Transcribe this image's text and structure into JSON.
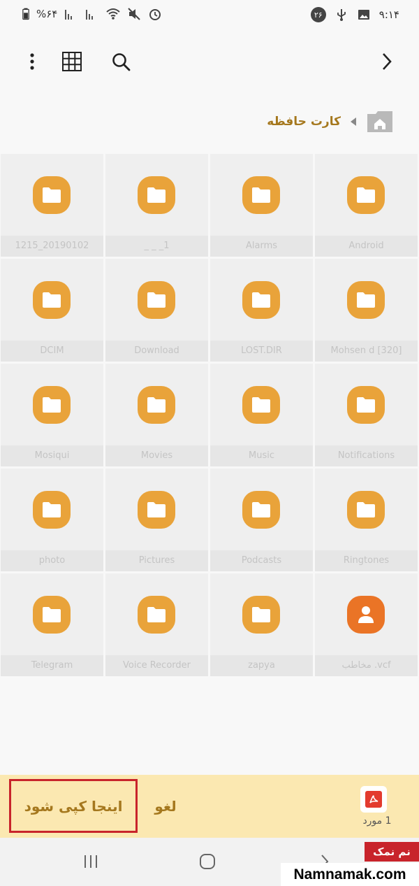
{
  "status_bar": {
    "battery": "%۶۴",
    "time": "۹:۱۴",
    "badge": "۲۶"
  },
  "toolbar": {
    "more_icon": "more-vert-icon",
    "grid_icon": "grid-view-icon",
    "search_icon": "search-icon",
    "back_icon": "chevron-right-icon"
  },
  "breadcrumb": {
    "label": "کارت حافظه",
    "home_icon": "home-icon"
  },
  "folders": [
    {
      "name": "Android",
      "type": "folder"
    },
    {
      "name": "Alarms",
      "type": "folder"
    },
    {
      "name": "_ _ _1",
      "type": "folder"
    },
    {
      "name": "1215_20190102",
      "type": "folder"
    },
    {
      "name": "Mohsen  d [320]",
      "type": "folder"
    },
    {
      "name": "LOST.DIR",
      "type": "folder"
    },
    {
      "name": "Download",
      "type": "folder"
    },
    {
      "name": "DCIM",
      "type": "folder"
    },
    {
      "name": "Notifications",
      "type": "folder"
    },
    {
      "name": "Music",
      "type": "folder"
    },
    {
      "name": "Movies",
      "type": "folder"
    },
    {
      "name": "Mosiqui",
      "type": "folder"
    },
    {
      "name": "Ringtones",
      "type": "folder"
    },
    {
      "name": "Podcasts",
      "type": "folder"
    },
    {
      "name": "Pictures",
      "type": "folder"
    },
    {
      "name": "photo",
      "type": "folder"
    },
    {
      "name": "مخاطب .vcf",
      "type": "contact"
    },
    {
      "name": "zapya",
      "type": "folder"
    },
    {
      "name": "Voice Recorder",
      "type": "folder"
    },
    {
      "name": "Telegram",
      "type": "folder"
    }
  ],
  "action_bar": {
    "copy_label": "اینجا کپی شود",
    "cancel_label": "لغو",
    "count_label": "1 مورد",
    "file_icon": "pdf-icon"
  },
  "nav_bar": {
    "recents_icon": "recents-icon",
    "home_icon": "home-circle-icon",
    "back_icon": "back-icon"
  },
  "watermark": {
    "brand_fa": "نم نمک",
    "brand_en": "Namnamak.com"
  },
  "colors": {
    "folder": "#e9a33a",
    "contact": "#ea7426",
    "accent_text": "#a5781e",
    "action_bar_bg": "#fbe8b1",
    "highlight_border": "#c8242b"
  }
}
